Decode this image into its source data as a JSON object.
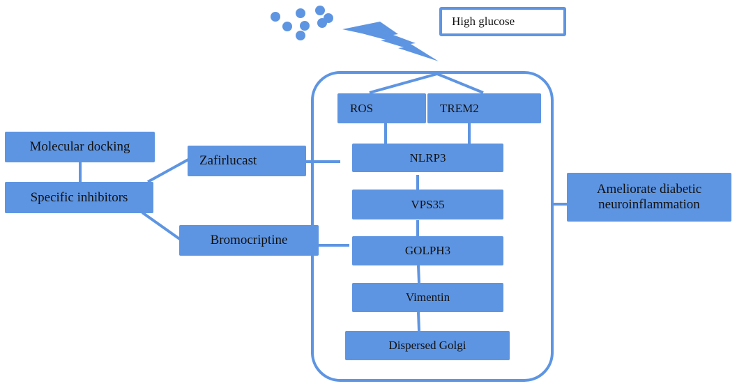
{
  "colors": {
    "accent": "#5e95e2",
    "background": "#ffffff",
    "text": "#111111"
  },
  "stimulus": {
    "label": "High glucose",
    "glucose_icon": "glucose-particles-icon",
    "signal_icon": "lightning-bolt-icon"
  },
  "cell_nodes": {
    "ros": "ROS",
    "trem2": "TREM2",
    "nlrp3": "NLRP3",
    "vps35": "VPS35",
    "golph3": "GOLPH3",
    "vimentin": "Vimentin",
    "dispersed_golgi": "Dispersed Golgi"
  },
  "left_nodes": {
    "molecular_docking": "Molecular docking",
    "specific_inhibitors": "Specific inhibitors",
    "zafirlucast": "Zafirlucast",
    "bromocriptine": "Bromocriptine"
  },
  "outcome": {
    "line1": "Ameliorate diabetic",
    "line2": "neuroinflammation"
  }
}
